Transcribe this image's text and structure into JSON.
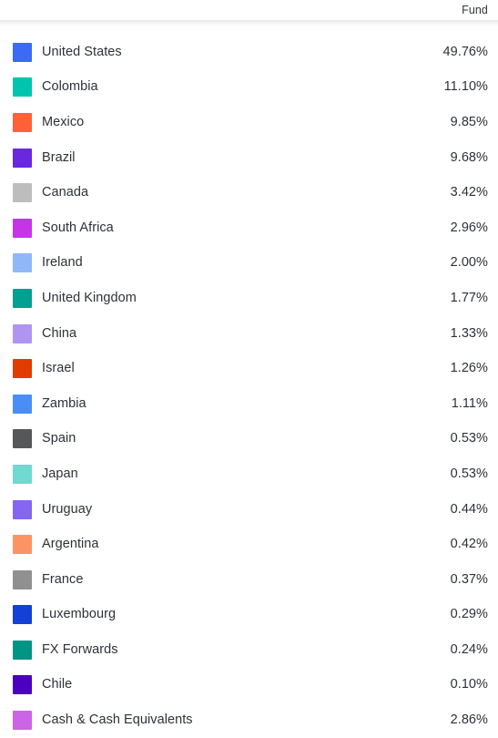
{
  "header": {
    "fund_column_label": "Fund"
  },
  "chart_data": {
    "type": "table",
    "title": "",
    "xlabel": "",
    "ylabel": "Fund",
    "legend_position": "inline-left",
    "grid": false,
    "categories": [
      "United States",
      "Colombia",
      "Mexico",
      "Brazil",
      "Canada",
      "South Africa",
      "Ireland",
      "United Kingdom",
      "China",
      "Israel",
      "Zambia",
      "Spain",
      "Japan",
      "Uruguay",
      "Argentina",
      "France",
      "Luxembourg",
      "FX Forwards",
      "Chile",
      "Cash & Cash Equivalents"
    ],
    "values": [
      49.76,
      11.1,
      9.85,
      9.68,
      3.42,
      2.96,
      2.0,
      1.77,
      1.33,
      1.26,
      1.11,
      0.53,
      0.53,
      0.44,
      0.42,
      0.37,
      0.29,
      0.24,
      0.1,
      2.86
    ],
    "value_labels": [
      "49.76%",
      "11.10%",
      "9.85%",
      "9.68%",
      "3.42%",
      "2.96%",
      "2.00%",
      "1.77%",
      "1.33%",
      "1.26%",
      "1.11%",
      "0.53%",
      "0.53%",
      "0.44%",
      "0.42%",
      "0.37%",
      "0.29%",
      "0.24%",
      "0.10%",
      "2.86%"
    ],
    "colors": [
      "#3b6bf5",
      "#00c4ae",
      "#ff6237",
      "#6a27e0",
      "#bdbdbd",
      "#c634e8",
      "#8fb8f8",
      "#02a090",
      "#b094f2",
      "#e03c00",
      "#4a8ef5",
      "#555759",
      "#6fd9d2",
      "#8466f0",
      "#fb9465",
      "#909090",
      "#1440d6",
      "#009484",
      "#4c00c0",
      "#cb64e6"
    ]
  },
  "rows": [
    {
      "name": "United States",
      "value": "49.76%",
      "color": "#3b6bf5"
    },
    {
      "name": "Colombia",
      "value": "11.10%",
      "color": "#00c4ae"
    },
    {
      "name": "Mexico",
      "value": "9.85%",
      "color": "#ff6237"
    },
    {
      "name": "Brazil",
      "value": "9.68%",
      "color": "#6a27e0"
    },
    {
      "name": "Canada",
      "value": "3.42%",
      "color": "#bdbdbd"
    },
    {
      "name": "South Africa",
      "value": "2.96%",
      "color": "#c634e8"
    },
    {
      "name": "Ireland",
      "value": "2.00%",
      "color": "#8fb8f8"
    },
    {
      "name": "United Kingdom",
      "value": "1.77%",
      "color": "#02a090"
    },
    {
      "name": "China",
      "value": "1.33%",
      "color": "#b094f2"
    },
    {
      "name": "Israel",
      "value": "1.26%",
      "color": "#e03c00"
    },
    {
      "name": "Zambia",
      "value": "1.11%",
      "color": "#4a8ef5"
    },
    {
      "name": "Spain",
      "value": "0.53%",
      "color": "#555759"
    },
    {
      "name": "Japan",
      "value": "0.53%",
      "color": "#6fd9d2"
    },
    {
      "name": "Uruguay",
      "value": "0.44%",
      "color": "#8466f0"
    },
    {
      "name": "Argentina",
      "value": "0.42%",
      "color": "#fb9465"
    },
    {
      "name": "France",
      "value": "0.37%",
      "color": "#909090"
    },
    {
      "name": "Luxembourg",
      "value": "0.29%",
      "color": "#1440d6"
    },
    {
      "name": "FX Forwards",
      "value": "0.24%",
      "color": "#009484"
    },
    {
      "name": "Chile",
      "value": "0.10%",
      "color": "#4c00c0"
    },
    {
      "name": "Cash & Cash Equivalents",
      "value": "2.86%",
      "color": "#cb64e6"
    }
  ]
}
